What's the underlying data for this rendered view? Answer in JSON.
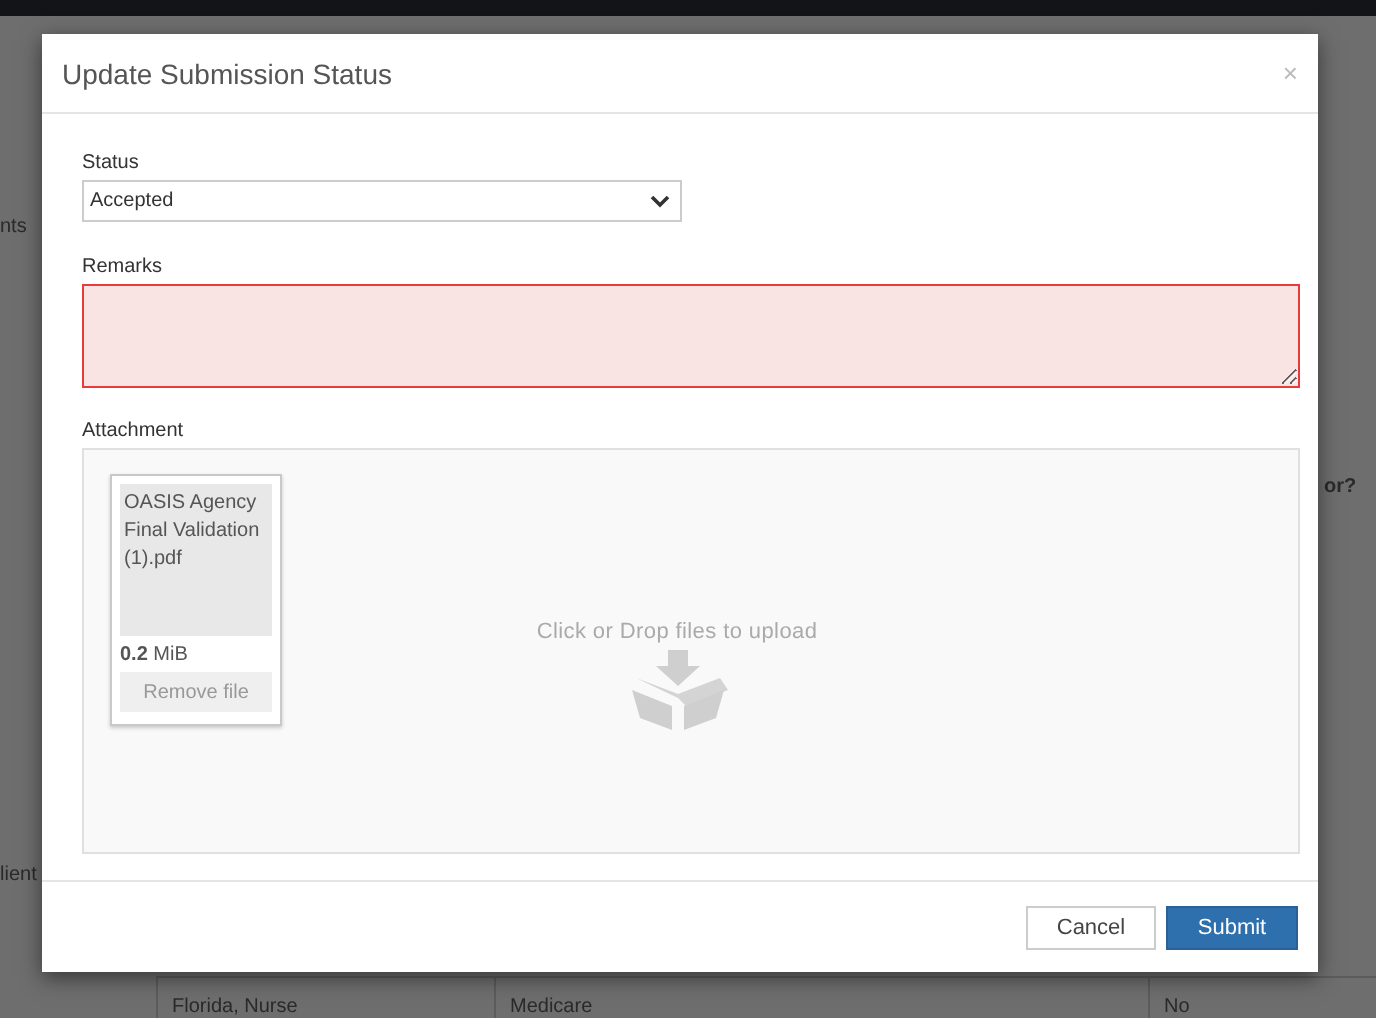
{
  "background": {
    "fragments": [
      {
        "text": "nts",
        "kind": "left"
      },
      {
        "text": "or?",
        "kind": "right"
      },
      {
        "text": "lient",
        "kind": "left2"
      }
    ],
    "bottom_row": [
      "Florida, Nurse",
      "Medicare",
      "No"
    ]
  },
  "dialog": {
    "title": "Update Submission Status",
    "close": "×",
    "status": {
      "label": "Status",
      "value": "Accepted"
    },
    "remarks": {
      "label": "Remarks",
      "invalid": true
    },
    "attachment": {
      "label": "Attachment",
      "hint": "Click or Drop files to upload",
      "files": [
        {
          "name": "OASIS Agency Final Validation (1).pdf",
          "size": "**0.2** MiB",
          "remove": "Remove file"
        }
      ]
    },
    "buttons": [
      {
        "label": "Cancel",
        "kind": "default"
      },
      {
        "label": "Submit",
        "kind": "primary"
      }
    ]
  }
}
